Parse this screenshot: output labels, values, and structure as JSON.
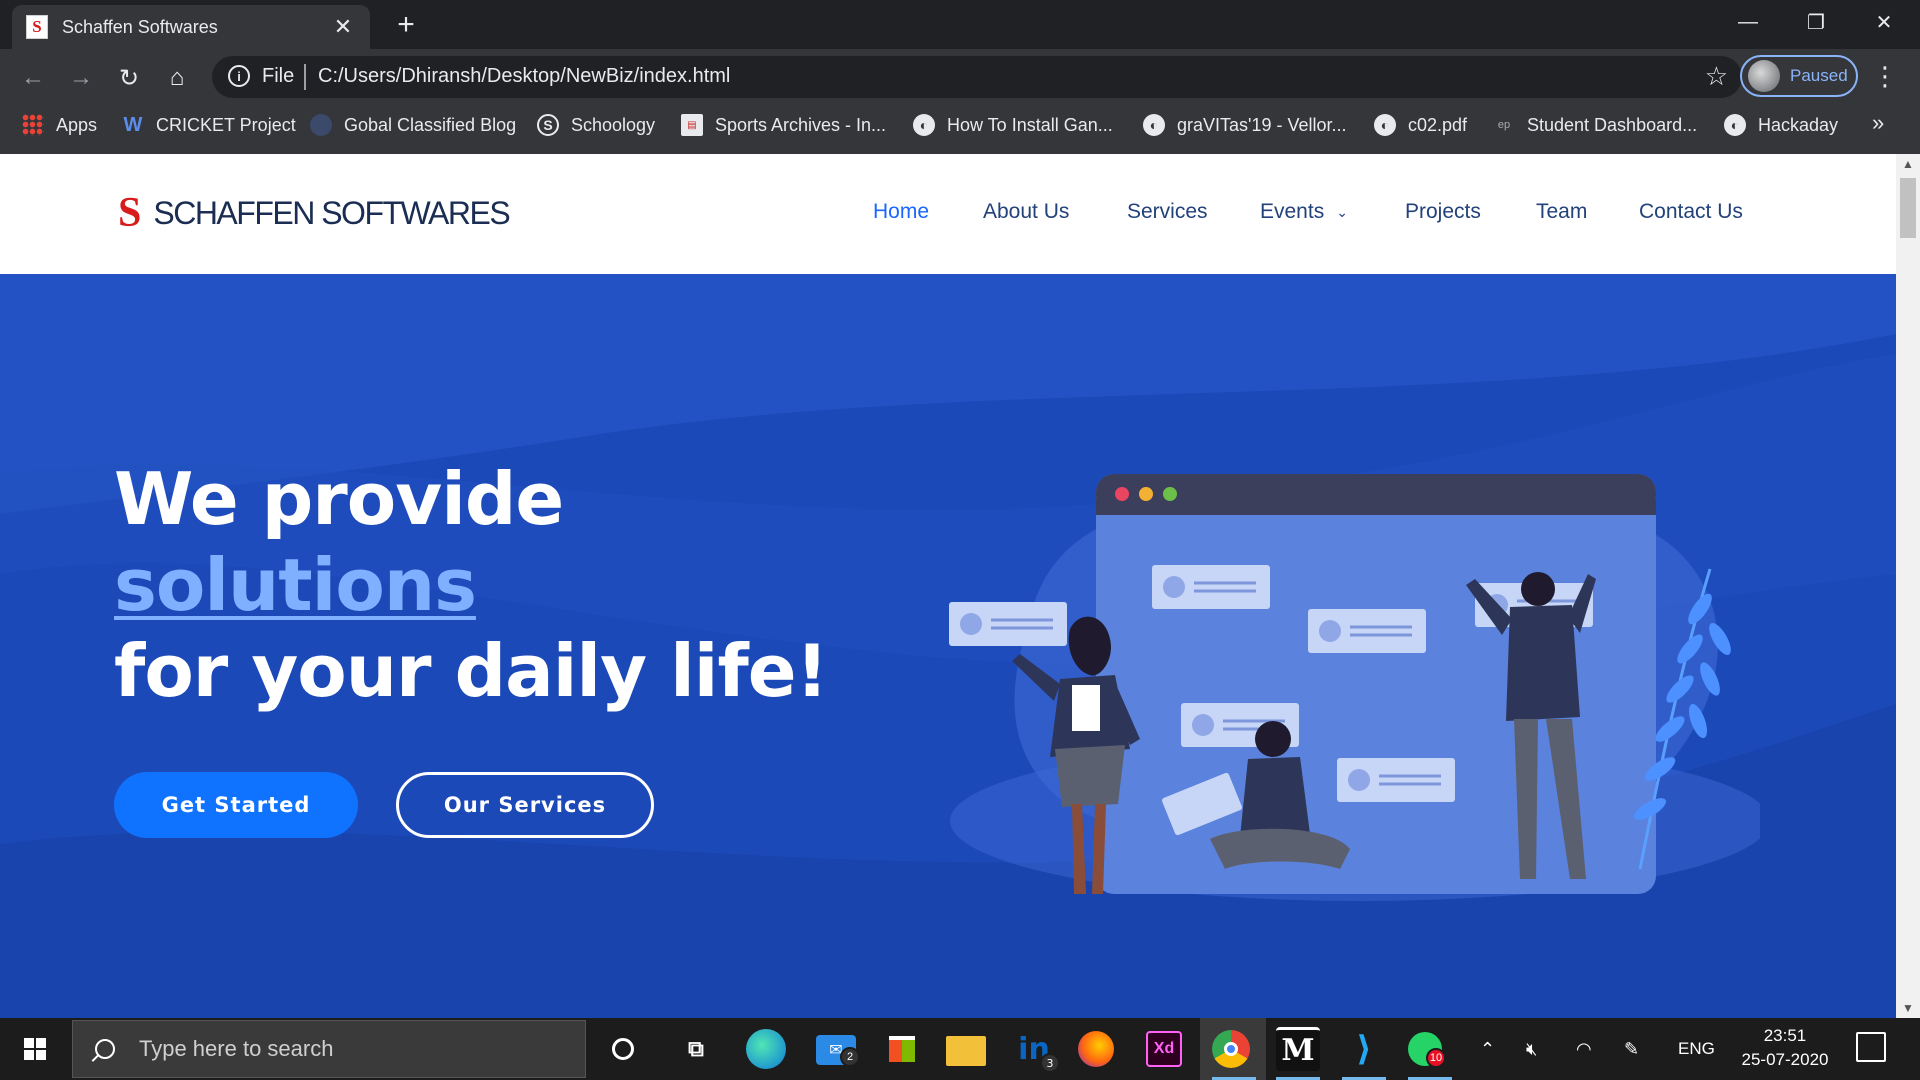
{
  "browser": {
    "tab_title": "Schaffen Softwares",
    "tab_favicon": "S",
    "new_tab": "+",
    "address_scheme": "File",
    "address_url": "C:/Users/Dhiransh/Desktop/NewBiz/index.html",
    "profile_label": "Paused",
    "bookmarks": [
      {
        "label": "Apps",
        "icon": "apps-grid-icon"
      },
      {
        "label": "CRICKET Project",
        "icon": "w-icon"
      },
      {
        "label": "Gobal Classified Blog",
        "icon": "blog-icon"
      },
      {
        "label": "Schoology",
        "icon": "schoology-icon"
      },
      {
        "label": "Sports Archives - In...",
        "icon": "sports-icon"
      },
      {
        "label": "How To Install Gan...",
        "icon": "globe-icon"
      },
      {
        "label": "graVITas'19 - Vellor...",
        "icon": "globe-icon"
      },
      {
        "label": "c02.pdf",
        "icon": "globe-icon"
      },
      {
        "label": "Student Dashboard...",
        "icon": "ep-icon"
      },
      {
        "label": "Hackaday",
        "icon": "globe-icon"
      }
    ],
    "bookmarks_overflow": "»"
  },
  "site": {
    "logo_mark": "S",
    "logo_text": "SCHAFFEN SOFTWARES",
    "nav": [
      {
        "label": "Home",
        "active": true
      },
      {
        "label": "About Us",
        "active": false
      },
      {
        "label": "Services",
        "active": false
      },
      {
        "label": "Events",
        "active": false,
        "dropdown": true
      },
      {
        "label": "Projects",
        "active": false
      },
      {
        "label": "Team",
        "active": false
      },
      {
        "label": "Contact Us",
        "active": false
      }
    ],
    "hero": {
      "line1": "We provide",
      "line2": "solutions",
      "line3": "for your daily life!",
      "primary_button": "Get Started",
      "secondary_button": "Our Services"
    },
    "colors": {
      "hero_bg": "#1c49b8",
      "accent": "#0f73ff",
      "nav_active": "#1a66ff",
      "nav_text": "#22427a",
      "logo_red": "#d81b1b"
    }
  },
  "taskbar": {
    "search_placeholder": "Type here to search",
    "mail_badge": "2",
    "linkedin_badge": "3",
    "whatsapp_badge": "10",
    "xd_label": "Xd",
    "language": "ENG",
    "time": "23:51",
    "date": "25-07-2020"
  }
}
